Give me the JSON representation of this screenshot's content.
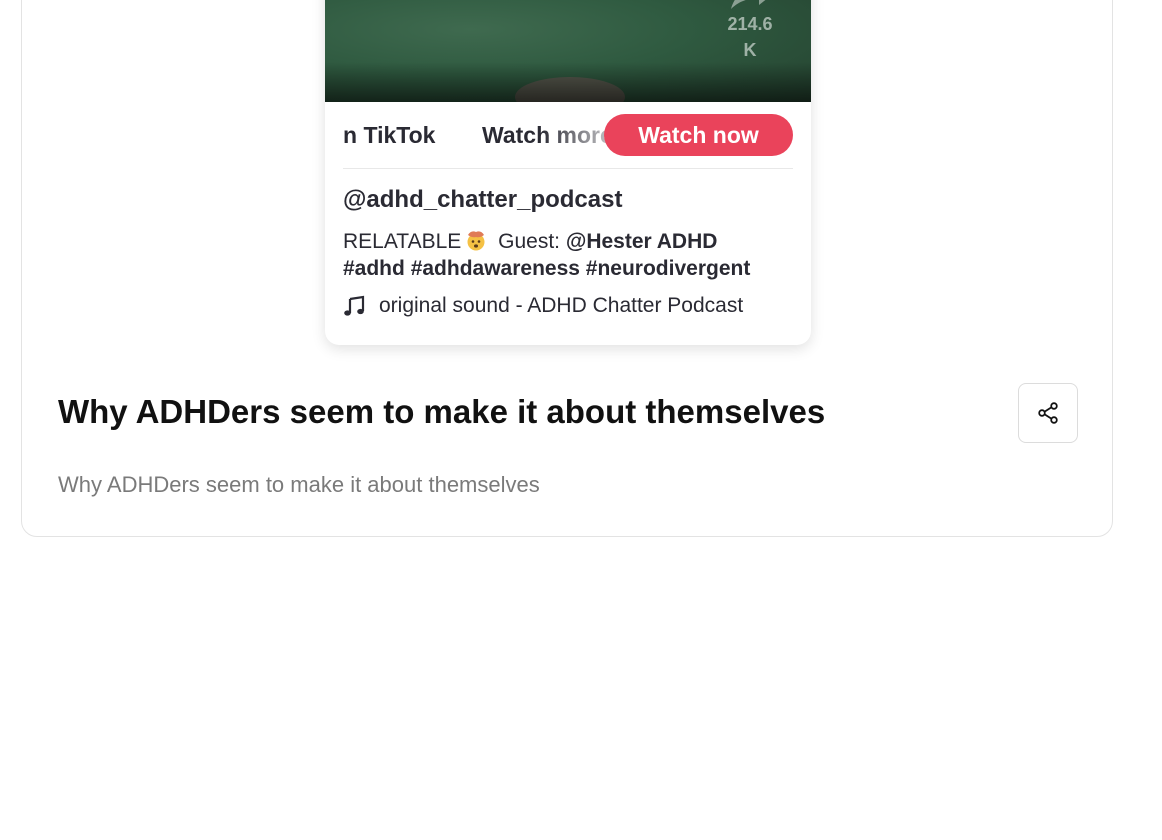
{
  "embed": {
    "share_count": "214.6 K",
    "cta": {
      "marquee_text_1": "n TikTok",
      "marquee_text_2": "Watch more",
      "watch_now_label": "Watch now"
    },
    "username": "@adhd_chatter_podcast",
    "caption": {
      "text_start": "RELATABLE",
      "guest_prefix": "Guest:",
      "guest_mention": "@Hester  ADHD",
      "hashtags": [
        "#adhd",
        "#adhdawareness",
        "#neurodivergent"
      ]
    },
    "music": {
      "icon": "music-note-icon",
      "label": "original sound - ADHD Chatter Podcast"
    }
  },
  "article": {
    "title": "Why ADHDers seem to make it about themselves",
    "description": "Why ADHDers seem to make it about themselves",
    "share_icon": "share-icon"
  },
  "colors": {
    "accent": "#ea435b",
    "title_text": "#111111",
    "description_text": "#7a7a7a",
    "video_background": "#2f5a40"
  }
}
